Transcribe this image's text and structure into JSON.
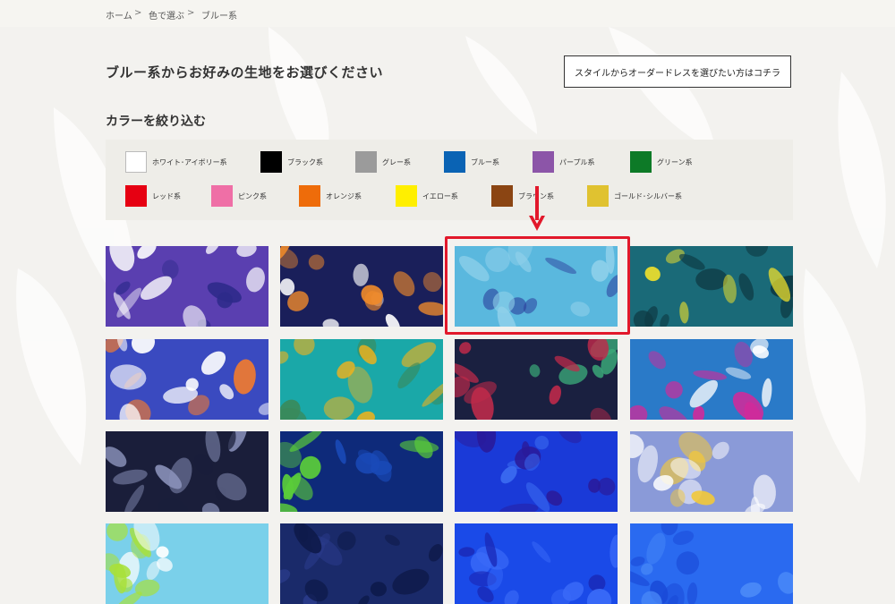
{
  "breadcrumb": {
    "items": [
      "ホーム",
      "色で選ぶ",
      "ブルー系"
    ],
    "separator": ">"
  },
  "page": {
    "title": "ブルー系からお好みの生地をお選びください"
  },
  "style_button": {
    "label": "スタイルからオーダードレスを選びたい方はコチラ"
  },
  "filter": {
    "title": "カラーを絞り込む",
    "colors": [
      {
        "label": "ホワイト･アイボリー系",
        "hex": "#ffffff"
      },
      {
        "label": "ブラック系",
        "hex": "#000000"
      },
      {
        "label": "グレー系",
        "hex": "#9b9b9b"
      },
      {
        "label": "ブルー系",
        "hex": "#0a63b4"
      },
      {
        "label": "パープル系",
        "hex": "#8c55a8"
      },
      {
        "label": "グリーン系",
        "hex": "#0d7a27"
      },
      {
        "label": "レッド系",
        "hex": "#e60012"
      },
      {
        "label": "ピンク系",
        "hex": "#ef6fa6"
      },
      {
        "label": "オレンジ系",
        "hex": "#ee6c0a"
      },
      {
        "label": "イエロー系",
        "hex": "#ffef00"
      },
      {
        "label": "ブラウン系",
        "hex": "#8b4513"
      },
      {
        "label": "ゴールド･シルバー系",
        "hex": "#e0c230"
      }
    ]
  },
  "fabrics": [
    {
      "name": "purple-hibiscus-fabric",
      "base": "#5a3fb0",
      "accent": "#ffffff",
      "accent2": "#2d2a8a"
    },
    {
      "name": "navy-orange-hibiscus-fabric",
      "base": "#1a1f5a",
      "accent": "#f08a2a",
      "accent2": "#ffffff"
    },
    {
      "name": "light-blue-fern-fabric",
      "base": "#5ab8de",
      "accent": "#8fd0ea",
      "accent2": "#2a3a9a"
    },
    {
      "name": "teal-fern-yellow-fabric",
      "base": "#1a6a78",
      "accent": "#0e3a44",
      "accent2": "#f2e22a"
    },
    {
      "name": "blue-leaf-daisy-fabric",
      "base": "#3a4ac0",
      "accent": "#ffffff",
      "accent2": "#f07a30"
    },
    {
      "name": "teal-yellow-orchid-fabric",
      "base": "#1aa8a8",
      "accent": "#f2b21a",
      "accent2": "#3a8a5a"
    },
    {
      "name": "navy-red-orchid-fabric",
      "base": "#1a2040",
      "accent": "#c02a4a",
      "accent2": "#3aa878"
    },
    {
      "name": "blue-pink-lei-fabric",
      "base": "#2a7ac8",
      "accent": "#d02a9a",
      "accent2": "#ffffff"
    },
    {
      "name": "navy-line-flower-fabric",
      "base": "#1a1e3a",
      "accent": "#8890b8",
      "accent2": "#1a1e3a"
    },
    {
      "name": "navy-green-tribal-fabric",
      "base": "#0e2a7a",
      "accent": "#5acc3a",
      "accent2": "#1a4ab8"
    },
    {
      "name": "royal-blue-flower-fabric",
      "base": "#1a3ad8",
      "accent": "#2a1a9a",
      "accent2": "#3a6af0"
    },
    {
      "name": "lavender-white-plumeria-fabric",
      "base": "#8a9ad8",
      "accent": "#ffffff",
      "accent2": "#f2c83a"
    },
    {
      "name": "lightblue-lime-flower-fabric",
      "base": "#7ad0ea",
      "accent": "#a8e03a",
      "accent2": "#ffffff"
    },
    {
      "name": "navy-rose-fabric",
      "base": "#1a2a6a",
      "accent": "#0e1a4a",
      "accent2": "#2a3a8a"
    },
    {
      "name": "bright-blue-flower-fabric",
      "base": "#1a4ae8",
      "accent": "#3a6af8",
      "accent2": "#1a2ab8"
    },
    {
      "name": "blue-lace-fabric",
      "base": "#2a6af0",
      "accent": "#1a4ad8",
      "accent2": "#4a8af8"
    }
  ]
}
